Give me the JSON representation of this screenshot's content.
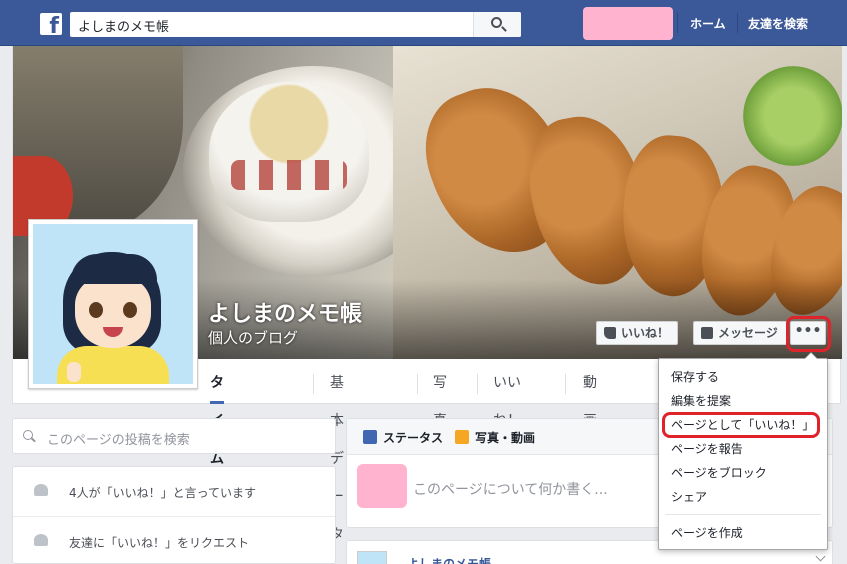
{
  "topbar": {
    "logo_letter": "f",
    "search_value": "よしまのメモ帳",
    "nav": [
      "ホーム",
      "友達を検索"
    ],
    "brand_color": "#3b5998"
  },
  "page": {
    "name": "よしまのメモ帳",
    "category": "個人のブログ"
  },
  "cover_buttons": {
    "like": "いいね！",
    "message": "メッセージ",
    "more": "•••"
  },
  "tabs": [
    "タイムライン",
    "基本データ",
    "写真",
    "いいね！",
    "動画"
  ],
  "menu": {
    "items": [
      "保存する",
      "編集を提案",
      "ページとして「いいね！」",
      "ページを報告",
      "ページをブロック",
      "シェア"
    ],
    "footer_item": "ページを作成",
    "highlight_color": "#e0222b"
  },
  "left": {
    "search_placeholder": "このページの投稿を検索",
    "rows": [
      "4人が「いいね！」と言っています",
      "友達に「いいね！」をリクエスト"
    ]
  },
  "composer": {
    "status": "ステータス",
    "photo": "写真・動画",
    "placeholder": "このページについて何か書く..."
  },
  "post": {
    "author": "よしまのメモ帳"
  }
}
